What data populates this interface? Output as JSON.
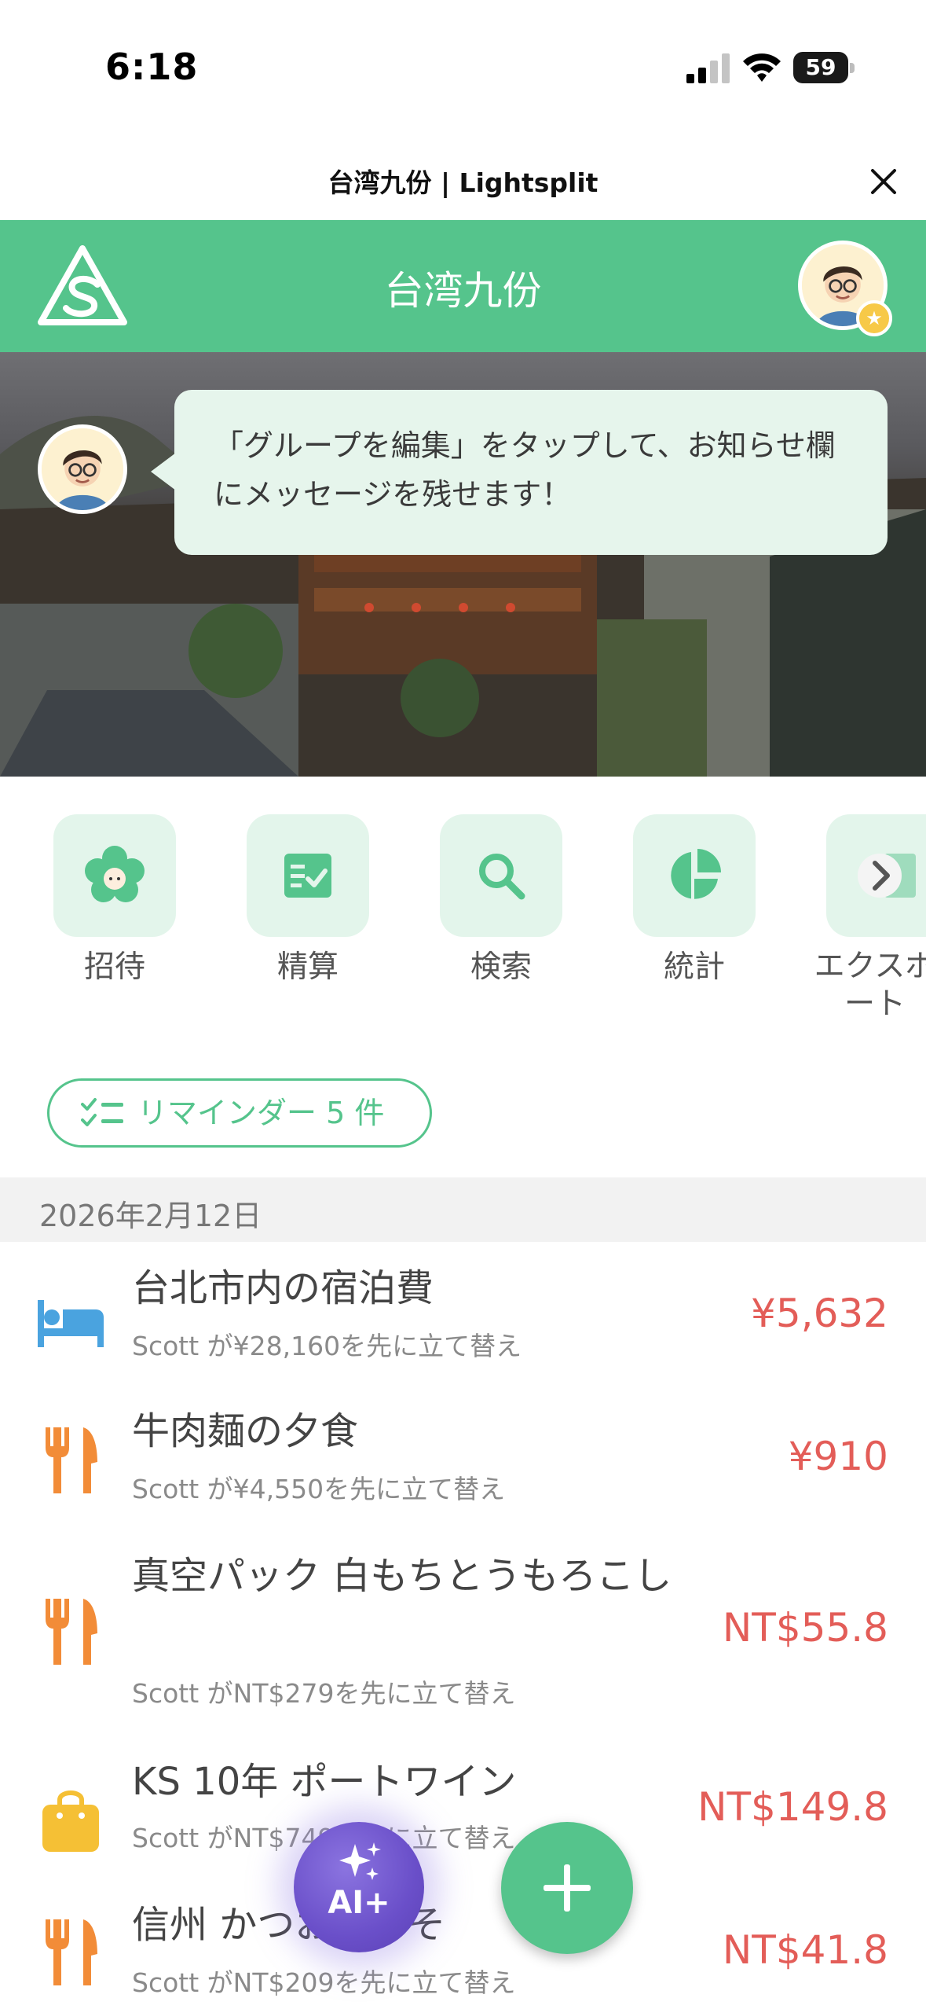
{
  "status_bar": {
    "time": "6:18",
    "battery": "59"
  },
  "webview": {
    "title": "台湾九份 | Lightsplit"
  },
  "header": {
    "group_name": "台湾九份"
  },
  "banner": {
    "bubble_text": "「グループを編集」をタップして、お知らせ欄にメッセージを残せます！"
  },
  "actions": [
    {
      "label": "招待",
      "icon": "invite-flower-icon"
    },
    {
      "label": "精算",
      "icon": "settle-check-icon"
    },
    {
      "label": "検索",
      "icon": "search-icon"
    },
    {
      "label": "統計",
      "icon": "pie-chart-icon"
    },
    {
      "label": "エクスポート",
      "icon": "export-icon"
    }
  ],
  "reminder": {
    "label": "リマインダー 5 件"
  },
  "date_header": "2026年2月12日",
  "expenses": [
    {
      "title": "台北市内の宿泊費",
      "subtitle": "Scott が¥28,160を先に立て替え",
      "amount": "¥5,632",
      "icon": "bed-icon"
    },
    {
      "title": "牛肉麺の夕食",
      "subtitle": "Scott が¥4,550を先に立て替え",
      "amount": "¥910",
      "icon": "fork-knife-icon"
    },
    {
      "title": "真空パック 白もちとうもろこし",
      "subtitle": "Scott がNT$279を先に立て替え",
      "amount": "NT$55.8",
      "icon": "fork-knife-icon"
    },
    {
      "title": "KS 10年 ポートワイン",
      "subtitle": "Scott がNT$749を先に立て替え",
      "amount": "NT$149.8",
      "icon": "shopping-bag-icon"
    },
    {
      "title": "信州 かつお節みそ",
      "subtitle": "Scott がNT$209を先に立て替え",
      "amount": "NT$41.8",
      "icon": "fork-knife-icon"
    }
  ],
  "fab": {
    "ai_label": "AI+"
  },
  "colors": {
    "brand": "#55c48c",
    "amount": "#e35d58",
    "tile": "#e3f5eb"
  }
}
